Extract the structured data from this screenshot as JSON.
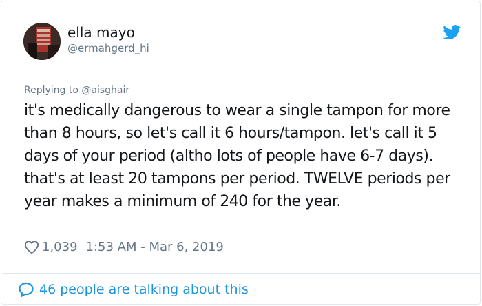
{
  "author": {
    "name": "ella mayo",
    "handle": "@ermahgerd_hi",
    "avatar_icon": "profile-photo"
  },
  "reply": {
    "label": "Replying to @aisghair"
  },
  "tweet": {
    "text": "it's medically dangerous to wear a single tampon for more than 8 hours, so let's call it 6 hours/tampon. let's call it 5 days of your period (altho lots of people have 6-7 days). that's at least 20 tampons per period. TWELVE periods per year makes a minimum of 240 for the year."
  },
  "meta": {
    "likes": "1,039",
    "timestamp": "1:53 AM - Mar 6, 2019"
  },
  "footer": {
    "talking": "46 people are talking about this"
  },
  "colors": {
    "accent": "#1da1f2",
    "link": "#1b95e0",
    "muted": "#657786",
    "text": "#14171a",
    "border": "#e1e8ed"
  },
  "icons": {
    "brand": "twitter-bird-icon",
    "like": "heart-icon",
    "conversation": "speech-bubble-icon"
  }
}
